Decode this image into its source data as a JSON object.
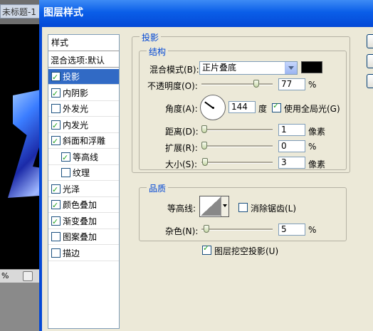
{
  "background_doc": {
    "tab_title": "未标题-1",
    "status_percent": "%"
  },
  "dialog": {
    "title": "图层样式"
  },
  "styles_list": {
    "header": "样式",
    "blend_options": "混合选项:默认",
    "items": [
      {
        "label": "投影",
        "checked": true,
        "selected": true,
        "sub": false
      },
      {
        "label": "内阴影",
        "checked": true,
        "selected": false,
        "sub": false
      },
      {
        "label": "外发光",
        "checked": false,
        "selected": false,
        "sub": false
      },
      {
        "label": "内发光",
        "checked": true,
        "selected": false,
        "sub": false
      },
      {
        "label": "斜面和浮雕",
        "checked": true,
        "selected": false,
        "sub": false
      },
      {
        "label": "等高线",
        "checked": true,
        "selected": false,
        "sub": true
      },
      {
        "label": "纹理",
        "checked": false,
        "selected": false,
        "sub": true
      },
      {
        "label": "光泽",
        "checked": true,
        "selected": false,
        "sub": false
      },
      {
        "label": "颜色叠加",
        "checked": true,
        "selected": false,
        "sub": false
      },
      {
        "label": "渐变叠加",
        "checked": true,
        "selected": false,
        "sub": false
      },
      {
        "label": "图案叠加",
        "checked": false,
        "selected": false,
        "sub": false
      },
      {
        "label": "描边",
        "checked": false,
        "selected": false,
        "sub": false
      }
    ]
  },
  "drop_shadow": {
    "title": "投影",
    "structure": {
      "title": "结构",
      "blend_mode_label": "混合模式(B):",
      "blend_mode_value": "正片叠底",
      "shadow_color": "#000000",
      "opacity_label": "不透明度(O):",
      "opacity_value": "77",
      "opacity_unit": "%",
      "angle_label": "角度(A):",
      "angle_value": "144",
      "angle_unit": "度",
      "global_light_label": "使用全局光(G)",
      "global_light_checked": true,
      "distance_label": "距离(D):",
      "distance_value": "1",
      "distance_unit": "像素",
      "spread_label": "扩展(R):",
      "spread_value": "0",
      "spread_unit": "%",
      "size_label": "大小(S):",
      "size_value": "3",
      "size_unit": "像素"
    },
    "quality": {
      "title": "品质",
      "contour_label": "等高线:",
      "antialias_label": "消除锯齿(L)",
      "antialias_checked": false,
      "noise_label": "杂色(N):",
      "noise_value": "5",
      "noise_unit": "%"
    },
    "knockout_label": "图层挖空投影(U)",
    "knockout_checked": true
  }
}
